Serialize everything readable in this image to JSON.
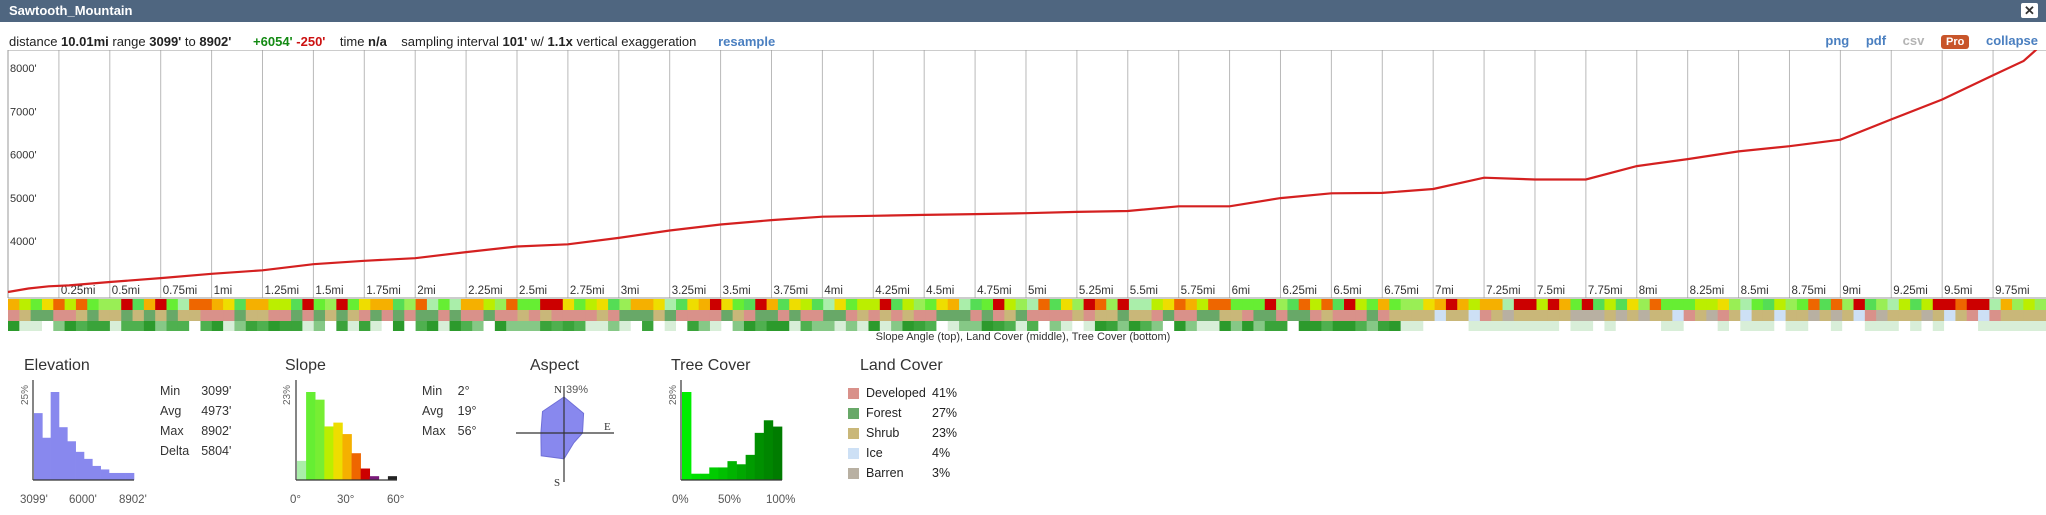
{
  "window": {
    "title": "Sawtooth_Mountain",
    "close": "✕"
  },
  "stats": {
    "distance_label": "distance",
    "distance": "10.01mi",
    "range_label": "range",
    "range_min": "3099'",
    "to_label": "to",
    "range_max": "8902'",
    "gain": "+6054'",
    "loss": "-250'",
    "time_label": "time",
    "time": "n/a",
    "sampling_label": "sampling interval",
    "sampling": "101'",
    "with_label": "w/",
    "exaggeration": "1.1x",
    "exag_label": "vertical exaggeration",
    "resample": "resample"
  },
  "toolbar": {
    "png": "png",
    "pdf": "pdf",
    "csv": "csv",
    "pro": "Pro",
    "collapse": "collapse"
  },
  "profile": {
    "y_ticks": [
      {
        "label": "8000'",
        "value": 8000
      },
      {
        "label": "7000'",
        "value": 7000
      },
      {
        "label": "6000'",
        "value": 6000
      },
      {
        "label": "5000'",
        "value": 5000
      },
      {
        "label": "4000'",
        "value": 4000
      }
    ],
    "x_ticks": [
      "0.25mi",
      "0.5mi",
      "0.75mi",
      "1mi",
      "1.25mi",
      "1.5mi",
      "1.75mi",
      "2mi",
      "2.25mi",
      "2.5mi",
      "2.75mi",
      "3mi",
      "3.25mi",
      "3.5mi",
      "3.75mi",
      "4mi",
      "4.25mi",
      "4.5mi",
      "4.75mi",
      "5mi",
      "5.25mi",
      "5.5mi",
      "5.75mi",
      "6mi",
      "6.25mi",
      "6.5mi",
      "6.75mi",
      "7mi",
      "7.25mi",
      "7.5mi",
      "7.75mi",
      "8mi",
      "8.25mi",
      "8.5mi",
      "8.75mi",
      "9mi",
      "9.25mi",
      "9.5mi",
      "9.75mi"
    ],
    "line_color": "#d42020",
    "strips_caption": "Slope Angle (top), Land Cover (middle), Tree Cover (bottom)"
  },
  "chart_data": [
    {
      "type": "line",
      "title": "",
      "xlabel": "",
      "ylabel": "",
      "xlim": [
        0,
        10.01
      ],
      "ylim": [
        3099,
        8902
      ],
      "series": [
        {
          "x": [
            0,
            0.1,
            0.2,
            0.3,
            0.5,
            0.75,
            1,
            1.25,
            1.5,
            1.75,
            2,
            2.25,
            2.5,
            2.75,
            3,
            3.25,
            3.5,
            3.75,
            4,
            4.25,
            4.5,
            4.75,
            5,
            5.25,
            5.5,
            5.75,
            6,
            6.25,
            6.5,
            6.75,
            7,
            7.25,
            7.5,
            7.75,
            8,
            8.25,
            8.5,
            8.75,
            9,
            9.25,
            9.5,
            9.75,
            9.9,
            10.01
          ],
          "y": [
            3099,
            3180,
            3230,
            3250,
            3330,
            3420,
            3520,
            3600,
            3740,
            3820,
            3880,
            4020,
            4150,
            4200,
            4350,
            4520,
            4660,
            4760,
            4840,
            4860,
            4880,
            4900,
            4920,
            4950,
            4970,
            5080,
            5080,
            5270,
            5380,
            5390,
            5480,
            5740,
            5700,
            5700,
            6010,
            6170,
            6350,
            6470,
            6620,
            7090,
            7550,
            8110,
            8440,
            8902
          ]
        }
      ]
    },
    {
      "type": "bar",
      "title": "Elevation",
      "categories": [
        "3099'",
        "",
        "",
        "",
        "",
        "",
        "",
        "",
        "",
        "",
        "",
        "8902'"
      ],
      "values": [
        19,
        12,
        25,
        15,
        11,
        8,
        6,
        4,
        3,
        2,
        2,
        2
      ],
      "ylabel": "25%",
      "ylim": [
        0,
        25
      ],
      "color": "#8888ee"
    },
    {
      "type": "bar",
      "title": "Slope",
      "values": [
        5,
        23,
        21,
        14,
        15,
        12,
        7,
        3,
        1,
        0,
        1
      ],
      "ylabel": "23%",
      "ylim": [
        0,
        23
      ],
      "colors": [
        "#aaeeaa",
        "#66ee33",
        "#77ee33",
        "#bbee00",
        "#eedd00",
        "#f5b000",
        "#ee6600",
        "#cc0000",
        "#7a1a7a",
        "#2233aa",
        "#222222"
      ]
    },
    {
      "type": "pie",
      "title": "Aspect",
      "directions": [
        "N",
        "NE",
        "E",
        "SE",
        "S",
        "SW",
        "W",
        "NW"
      ],
      "values": [
        39,
        30,
        20,
        15,
        28,
        35,
        25,
        33
      ],
      "max_label": "39%"
    },
    {
      "type": "bar",
      "title": "Tree Cover",
      "values": [
        28,
        2,
        2,
        4,
        4,
        6,
        5,
        8,
        15,
        19,
        17
      ],
      "ylabel": "28%",
      "ylim": [
        0,
        28
      ],
      "colors": [
        "#00ee00",
        "#00e000",
        "#00d500",
        "#00cc00",
        "#00c000",
        "#00b400",
        "#00a800",
        "#009c00",
        "#009000",
        "#008600",
        "#007c00"
      ]
    }
  ],
  "panels": {
    "elevation": {
      "title": "Elevation",
      "y_label": "25%",
      "x_labels": [
        "3099'",
        "6000'",
        "8902'"
      ],
      "stats": [
        {
          "k": "Min",
          "v": "3099'"
        },
        {
          "k": "Avg",
          "v": "4973'"
        },
        {
          "k": "Max",
          "v": "8902'"
        },
        {
          "k": "Delta",
          "v": "5804'"
        }
      ]
    },
    "slope": {
      "title": "Slope",
      "y_label": "23%",
      "x_labels": [
        "0°",
        "30°",
        "60°"
      ],
      "stats": [
        {
          "k": "Min",
          "v": "2°"
        },
        {
          "k": "Avg",
          "v": "19°"
        },
        {
          "k": "Max",
          "v": "56°"
        }
      ]
    },
    "aspect": {
      "title": "Aspect",
      "n": "N",
      "e": "E",
      "s": "S",
      "max": "39%"
    },
    "tree": {
      "title": "Tree Cover",
      "y_label": "28%",
      "x_labels": [
        "0%",
        "50%",
        "100%"
      ]
    },
    "landcover": {
      "title": "Land Cover",
      "items": [
        {
          "name": "Developed",
          "pct": "41%",
          "color": "#d9918a"
        },
        {
          "name": "Forest",
          "pct": "27%",
          "color": "#68a868"
        },
        {
          "name": "Shrub",
          "pct": "23%",
          "color": "#c9b779"
        },
        {
          "name": "Ice",
          "pct": "4%",
          "color": "#cde0f5"
        },
        {
          "name": "Barren",
          "pct": "3%",
          "color": "#b8b0a2"
        }
      ]
    }
  }
}
